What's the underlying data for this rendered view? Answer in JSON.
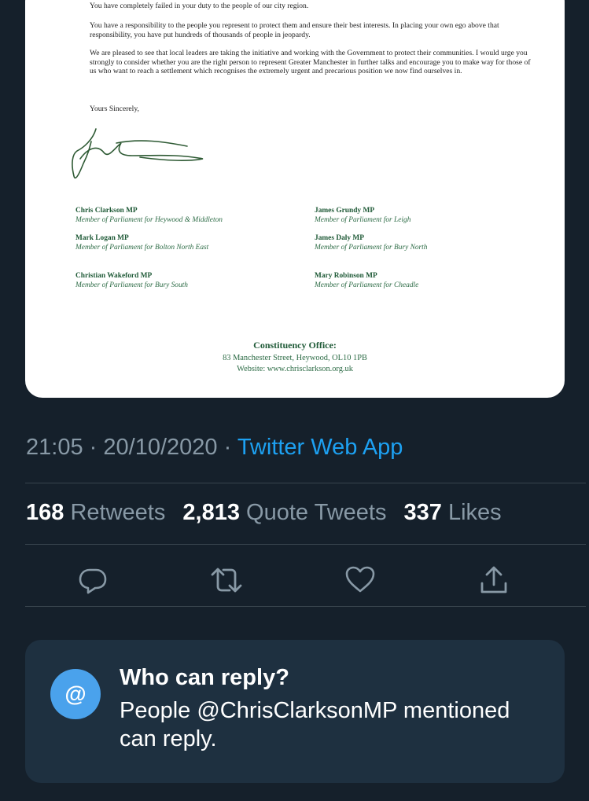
{
  "letter": {
    "paragraphs": [
      "You have completely failed in your duty to the people of our city region.",
      "You have a responsibility to the people you represent to protect them and ensure their best interests. In placing your own ego above that responsibility, you have put hundreds of thousands of people in jeopardy.",
      "We are pleased to see that local leaders are taking the initiative and working with the Government to protect their communities. I would urge you strongly to consider whether you are the right person to represent Greater Manchester in further talks and encourage you to make way for those of us who want to reach a settlement which recognises the extremely urgent and precarious position we now find ourselves in."
    ],
    "closing": "Yours Sincerely,",
    "mps": [
      {
        "name": "Chris Clarkson MP",
        "role": "Member of Parliament for Heywood & Middleton"
      },
      {
        "name": "James Grundy MP",
        "role": "Member of Parliament for Leigh"
      },
      {
        "name": "Mark Logan MP",
        "role": "Member of Parliament for Bolton North East"
      },
      {
        "name": "James Daly MP",
        "role": "Member of Parliament for Bury North"
      },
      {
        "name": "Christian Wakeford MP",
        "role": "Member of Parliament for Bury South"
      },
      {
        "name": "Mary Robinson MP",
        "role": "Member of Parliament for Cheadle"
      }
    ],
    "office": {
      "title": "Constituency Office:",
      "address": "83 Manchester Street, Heywood, OL10 1PB",
      "website": "Website: www.chrisclarkson.org.uk"
    }
  },
  "tweet": {
    "time": "21:05",
    "separator": "·",
    "date": "20/10/2020",
    "source": "Twitter Web App",
    "stats": {
      "retweets_count": "168",
      "retweets_label": "Retweets",
      "quotes_count": "2,813",
      "quotes_label": "Quote Tweets",
      "likes_count": "337",
      "likes_label": "Likes"
    },
    "actions": [
      "reply-icon",
      "retweet-icon",
      "like-icon",
      "share-icon"
    ]
  },
  "reply_settings": {
    "icon_symbol": "@",
    "title": "Who can reply?",
    "description": "People @ChrisClarksonMP mentioned can reply."
  },
  "colors": {
    "background": "#15202b",
    "accent": "#1da1f2",
    "muted": "#8899a6",
    "card": "#1e3040",
    "letter_green": "#1f5a37"
  }
}
